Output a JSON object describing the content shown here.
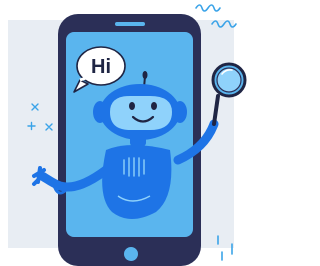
{
  "illustration": {
    "speech_bubble": {
      "text": "Hi"
    },
    "icons": [
      "phone-icon",
      "robot-icon",
      "magnifier-icon",
      "speech-bubble-icon"
    ],
    "colors": {
      "backdrop": "#e8edf3",
      "phone_body": "#2b2f57",
      "screen": "#5ab5ee",
      "robot": "#1e74e6",
      "robot_light": "#8fd2fb",
      "outline": "#1f2544",
      "bubble": "#ffffff",
      "accent": "#3aa3e8"
    }
  }
}
